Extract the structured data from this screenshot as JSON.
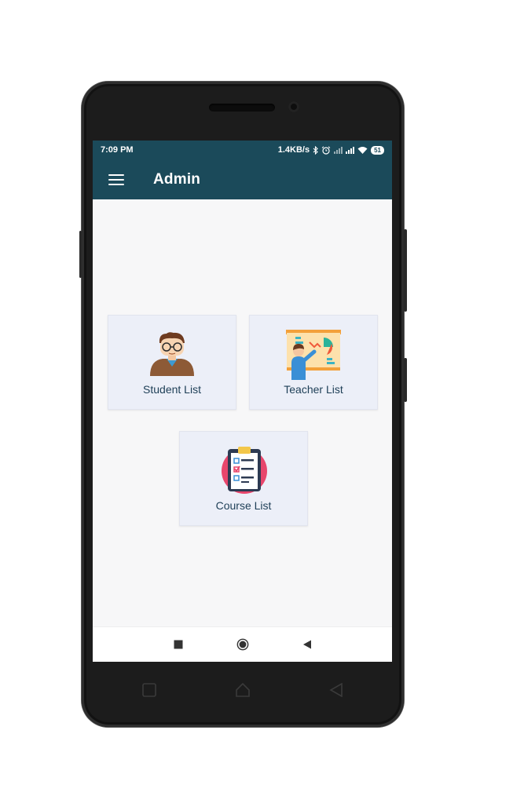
{
  "status_bar": {
    "time": "7:09 PM",
    "net_speed": "1.4KB/s",
    "battery": "51",
    "icons": [
      "bluetooth-icon",
      "alarm-icon",
      "signal-icon",
      "signal-icon",
      "wifi-icon",
      "battery-icon"
    ]
  },
  "app_bar": {
    "title": "Admin",
    "menu_icon": "hamburger-menu-icon"
  },
  "cards": [
    {
      "label": "Student List",
      "icon": "student-icon"
    },
    {
      "label": "Teacher List",
      "icon": "teacher-icon"
    },
    {
      "label": "Course List",
      "icon": "course-checklist-icon"
    }
  ],
  "nav_bar": {
    "icons": [
      "recents-square-icon",
      "home-circle-icon",
      "back-triangle-icon"
    ]
  },
  "colors": {
    "primary": "#1b4a5a",
    "card_bg": "#eceff8",
    "label": "#1d3e56",
    "screen_bg": "#f7f7f8"
  }
}
